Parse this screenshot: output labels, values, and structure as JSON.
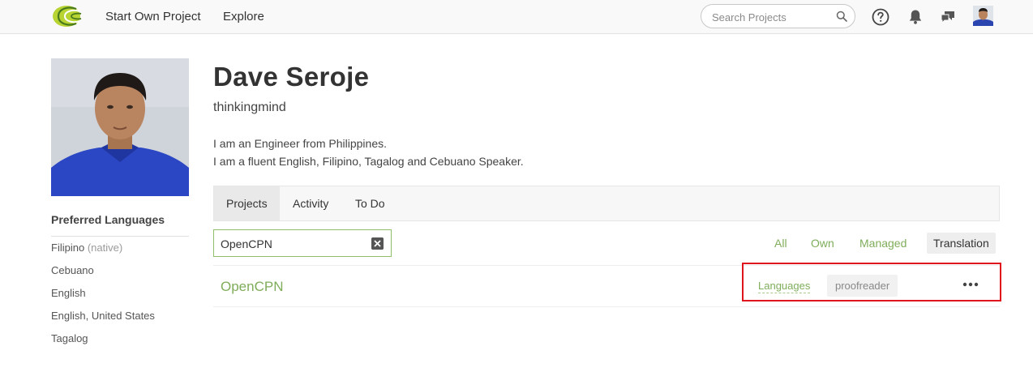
{
  "nav": {
    "start_own_project": "Start Own Project",
    "explore": "Explore",
    "search_placeholder": "Search Projects"
  },
  "profile": {
    "name": "Dave Seroje",
    "username": "thinkingmind",
    "bio_lines": [
      "I am an Engineer from Philippines.",
      "I am a fluent English, Filipino, Tagalog and Cebuano Speaker."
    ]
  },
  "preferred_languages": {
    "title": "Preferred Languages",
    "items": [
      {
        "label": "Filipino",
        "note": "(native)"
      },
      {
        "label": "Cebuano"
      },
      {
        "label": "English"
      },
      {
        "label": "English, United States"
      },
      {
        "label": "Tagalog"
      }
    ]
  },
  "tabs": [
    {
      "label": "Projects",
      "active": true
    },
    {
      "label": "Activity"
    },
    {
      "label": "To Do"
    }
  ],
  "filter": {
    "value": "OpenCPN",
    "options": [
      "All",
      "Own",
      "Managed",
      "Translation"
    ],
    "selected": "Translation"
  },
  "projects": [
    {
      "name": "OpenCPN",
      "languages_label": "Languages",
      "role": "proofreader"
    }
  ],
  "colors": {
    "accent_green": "#7fad5a",
    "highlight_red": "#e0141c"
  }
}
